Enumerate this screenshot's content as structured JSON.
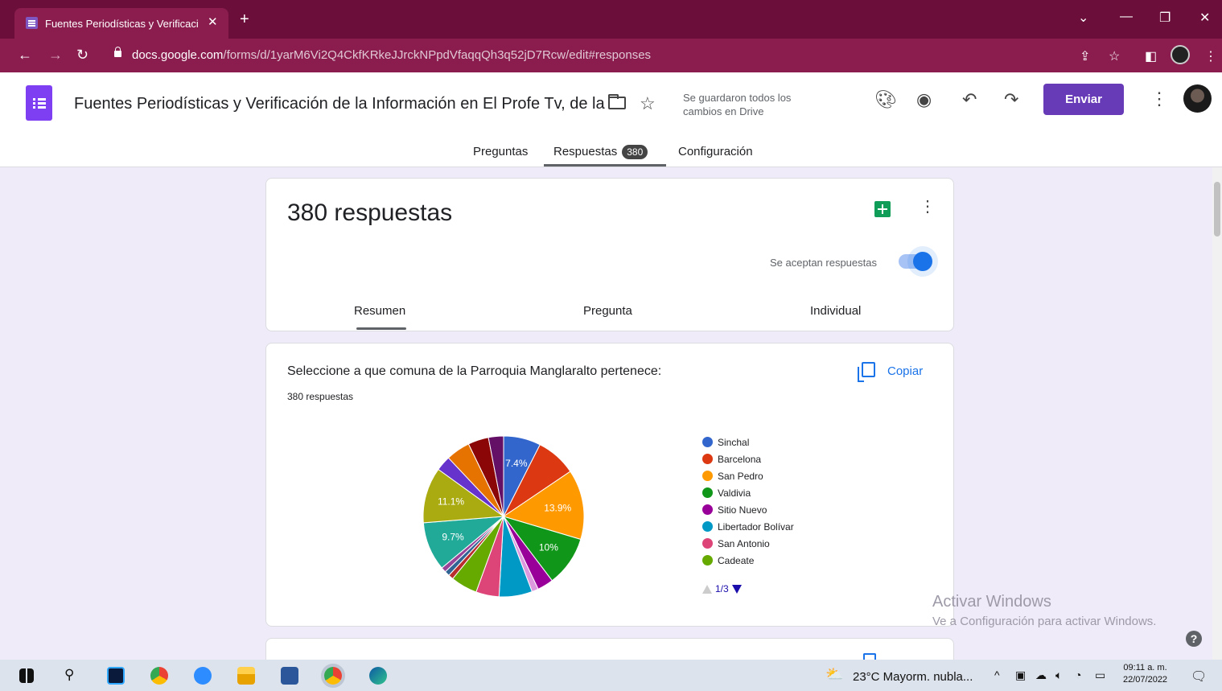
{
  "browser": {
    "tab_title": "Fuentes Periodísticas y Verificació",
    "tab_close": "✕",
    "new_tab": "+",
    "url_host": "docs.google.com",
    "url_path": "/forms/d/1yarM6Vi2Q4CkfKRkeJJrckNPpdVfaqqQh3q52jD7Rcw/edit#responses"
  },
  "header": {
    "form_title": "Fuentes Periodísticas y Verificación de la Información en El Profe Tv, de la",
    "saved_status": "Se guardaron todos los cambios en Drive",
    "send_label": "Enviar"
  },
  "tabs": [
    {
      "label": "Preguntas"
    },
    {
      "label": "Respuestas",
      "badge": "380"
    },
    {
      "label": "Configuración"
    }
  ],
  "summary_card": {
    "responses_heading": "380 respuestas",
    "accepting_label": "Se aceptan respuestas",
    "accepting": true,
    "subtabs": [
      "Resumen",
      "Pregunta",
      "Individual"
    ]
  },
  "question_card": {
    "title": "Seleccione a que comuna de la Parroquia Manglaralto pertenece:",
    "count": "380 respuestas",
    "copy_label": "Copiar",
    "pager": "1/3"
  },
  "chart_data": {
    "type": "pie",
    "labels_visible": [
      "Sinchal",
      "Barcelona",
      "San Pedro",
      "Valdivia",
      "Sitio Nuevo",
      "Libertador Bolívar",
      "San Antonio",
      "Cadeate"
    ],
    "slices": [
      {
        "name": "Sinchal",
        "value": 7.4,
        "color": "#3366cc",
        "label": "7.4%"
      },
      {
        "name": "Barcelona",
        "value": 8.0,
        "color": "#dc3912"
      },
      {
        "name": "San Pedro",
        "value": 13.9,
        "color": "#ff9900",
        "label": "13.9%"
      },
      {
        "name": "Valdivia",
        "value": 10.0,
        "color": "#109618",
        "label": "10%"
      },
      {
        "name": "Sitio Nuevo",
        "value": 3.2,
        "color": "#990099"
      },
      {
        "name": "",
        "value": 1.3,
        "color": "#dd99dd"
      },
      {
        "name": "Libertador Bolívar",
        "value": 6.6,
        "color": "#0099c6"
      },
      {
        "name": "San Antonio",
        "value": 4.6,
        "color": "#dd4477"
      },
      {
        "name": "Cadeate",
        "value": 5.3,
        "color": "#66aa00"
      },
      {
        "name": "",
        "value": 1.0,
        "color": "#b82e2e"
      },
      {
        "name": "",
        "value": 1.0,
        "color": "#316395"
      },
      {
        "name": "",
        "value": 1.0,
        "color": "#994499"
      },
      {
        "name": "",
        "value": 9.7,
        "color": "#22aa99",
        "label": "9.7%"
      },
      {
        "name": "",
        "value": 11.1,
        "color": "#aaaa11",
        "label": "11.1%"
      },
      {
        "name": "",
        "value": 3.0,
        "color": "#6633cc"
      },
      {
        "name": "",
        "value": 4.8,
        "color": "#e67300"
      },
      {
        "name": "",
        "value": 4.1,
        "color": "#8b0707"
      },
      {
        "name": "",
        "value": 3.0,
        "color": "#651067"
      }
    ]
  },
  "watermark": {
    "line1": "Activar Windows",
    "line2": "Ve a Configuración para activar Windows."
  },
  "taskbar": {
    "weather": "23°C  Mayorm. nubla...",
    "time": "09:11 a. m.",
    "date": "22/07/2022"
  },
  "colors": {
    "chrome_tab_bar": "#6b0f3a",
    "chrome_address_bar": "#8a1d4e",
    "forms_purple": "#673ab7",
    "content_bg": "#f0ebf8",
    "link_blue": "#1a73e8"
  }
}
